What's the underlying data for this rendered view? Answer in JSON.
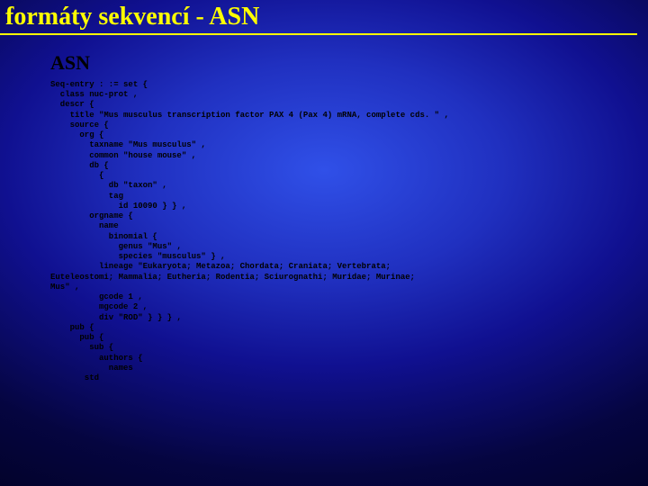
{
  "title": "formáty sekvencí - ASN",
  "subtitle": "ASN",
  "code": "Seq-entry : := set {\n  class nuc-prot ,\n  descr {\n    title \"Mus musculus transcription factor PAX 4 (Pax 4) mRNA, complete cds. \" ,\n    source {\n      org {\n        taxname \"Mus musculus\" ,\n        common \"house mouse\" ,\n        db {\n          {\n            db \"taxon\" ,\n            tag\n              id 10090 } } ,\n        orgname {\n          name\n            binomial {\n              genus \"Mus\" ,\n              species \"musculus\" } ,\n          lineage \"Eukaryota; Metazoa; Chordata; Craniata; Vertebrata;\nEuteleostomi; Mammalia; Eutheria; Rodentia; Sciurognathi; Muridae; Murinae;\nMus\" ,\n          gcode 1 ,\n          mgcode 2 ,\n          div \"ROD\" } } } ,\n    pub {\n      pub {\n        sub {\n          authors {\n            names\n       std"
}
